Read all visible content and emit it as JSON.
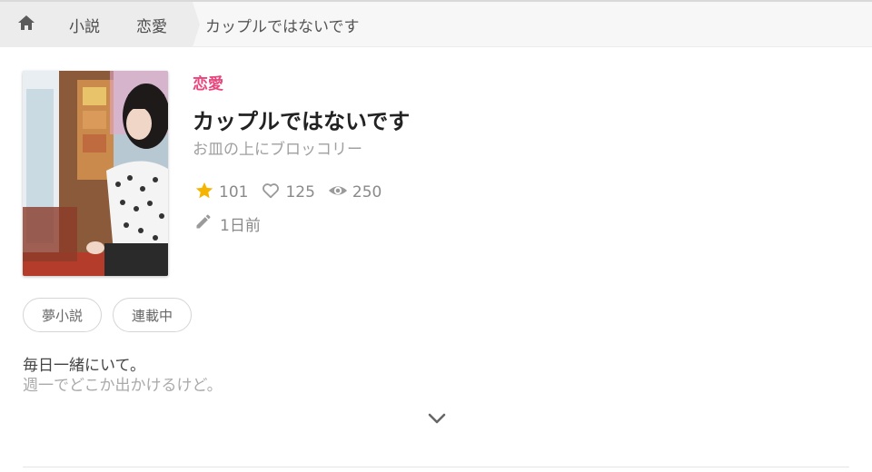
{
  "breadcrumb": {
    "home_icon": "home-icon",
    "items": [
      "小説",
      "恋愛"
    ],
    "current": "カップルではないです"
  },
  "story": {
    "genre": "恋愛",
    "title": "カップルではないです",
    "author": "お皿の上にブロッコリー",
    "stats": {
      "stars": "101",
      "likes": "125",
      "views": "250"
    },
    "updated": "1日前",
    "tags": [
      "夢小説",
      "連載中"
    ],
    "description": [
      "毎日一緒にいて。",
      "週一でどこか出かけるけど。"
    ]
  },
  "colors": {
    "genre": "#e8467c",
    "star": "#f5b400",
    "icon": "#9a9a9a"
  },
  "icons": [
    "home-icon",
    "star-icon",
    "heart-icon",
    "eye-icon",
    "pencil-icon",
    "chevron-down-icon"
  ]
}
